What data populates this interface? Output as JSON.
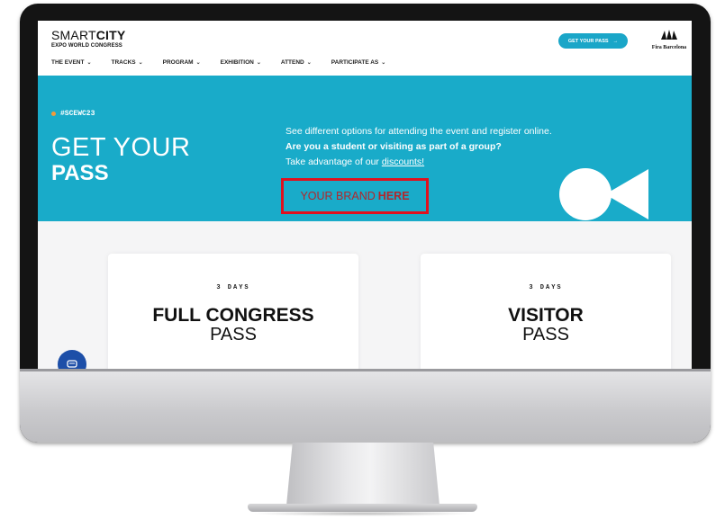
{
  "header": {
    "logo_light": "SMART",
    "logo_bold": "CITY",
    "logo_sub": "EXPO WORLD CONGRESS",
    "pass_button": "GET YOUR PASS",
    "pass_arrow": "→",
    "fira_logo": "Fira Barcelona"
  },
  "nav": [
    {
      "label": "THE EVENT"
    },
    {
      "label": "TRACKS"
    },
    {
      "label": "PROGRAM"
    },
    {
      "label": "EXHIBITION"
    },
    {
      "label": "ATTEND"
    },
    {
      "label": "PARTICIPATE AS"
    }
  ],
  "hero": {
    "tag": "#SCEWC23",
    "title_line1": "GET YOUR",
    "title_line2": "PASS",
    "line1": "See different options for attending the event and register online.",
    "line2": "Are you a student or visiting as part of a group?",
    "line3_prefix": "Take advantage of our ",
    "line3_link": "discounts!",
    "brand_text": "YOUR BRAND",
    "brand_bold": "HERE"
  },
  "cards": [
    {
      "days": "3 DAYS",
      "title": "FULL CONGRESS",
      "subtitle": "PASS"
    },
    {
      "days": "3 DAYS",
      "title": "VISITOR",
      "subtitle": "PASS"
    }
  ],
  "colors": {
    "hero_bg": "#19abc9",
    "accent_button": "#1aa6c8",
    "highlight_box": "#e0111e",
    "tag_dot": "#f29a3a",
    "chat_button": "#1d4fa8"
  }
}
